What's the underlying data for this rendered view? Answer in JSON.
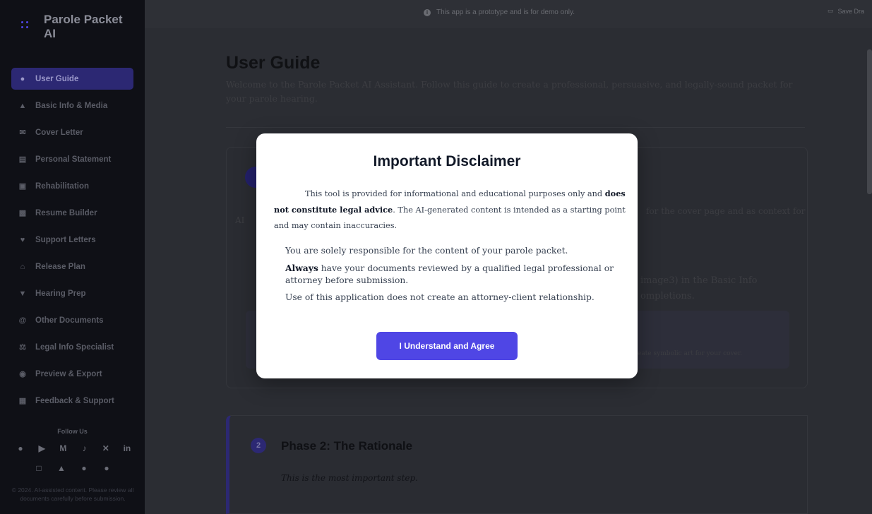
{
  "brand": {
    "title": "Parole Packet AI"
  },
  "sidebar": {
    "items": [
      {
        "label": "User Guide",
        "icon": "info-icon",
        "active": true
      },
      {
        "label": "Basic Info & Media",
        "icon": "user-icon"
      },
      {
        "label": "Cover Letter",
        "icon": "envelope-icon"
      },
      {
        "label": "Personal Statement",
        "icon": "file-icon"
      },
      {
        "label": "Rehabilitation",
        "icon": "clipboard-icon"
      },
      {
        "label": "Resume Builder",
        "icon": "briefcase-icon"
      },
      {
        "label": "Support Letters",
        "icon": "heart-icon"
      },
      {
        "label": "Release Plan",
        "icon": "home-icon"
      },
      {
        "label": "Hearing Prep",
        "icon": "gavel-icon"
      },
      {
        "label": "Other Documents",
        "icon": "at-icon"
      },
      {
        "label": "Legal Info Specialist",
        "icon": "scale-icon"
      },
      {
        "label": "Preview & Export",
        "icon": "eye-icon"
      },
      {
        "label": "Feedback & Support",
        "icon": "message-icon"
      }
    ],
    "follow_label": "Follow Us",
    "copyright": "© 2024. AI-assisted content. Please review all documents carefully before submission."
  },
  "topbar": {
    "prototype_notice": "This app is a prototype and is for demo only.",
    "save_label": "Save Dra"
  },
  "main": {
    "title": "User Guide",
    "intro": "Welcome to the Parole Packet AI Assistant. Follow this guide to create a professional, persuasive, and legally-sound packet for your parole hearing.",
    "frag_ai": "AI",
    "frag_cover": "for the cover page and as context for",
    "frag_image": "image3) in the Basic Info",
    "frag_completions": "ompletions.",
    "frag_symbolic": "eate symbolic art for your cover.",
    "phase2_number": "2",
    "phase2_title": "Phase 2: The Rationale",
    "phase2_note": "This is the most important step."
  },
  "modal": {
    "title": "Important Disclaimer",
    "p1_start": "This tool is provided for informational and educational purposes only and ",
    "p1_bold": "does not constitute legal advice",
    "p1_end": ". The AI-generated content is intended as a starting point and may contain inaccuracies.",
    "item1": "You are solely responsible for the content of your parole packet.",
    "item2_bold": "Always",
    "item2_rest": " have your documents reviewed by a qualified legal professional or attorney before submission.",
    "item3": "Use of this application does not create an attorney-client relationship.",
    "agree_label": "I Understand and Agree"
  },
  "colors": {
    "accent": "#4f46e5",
    "sidebar_bg": "#0f1016"
  }
}
